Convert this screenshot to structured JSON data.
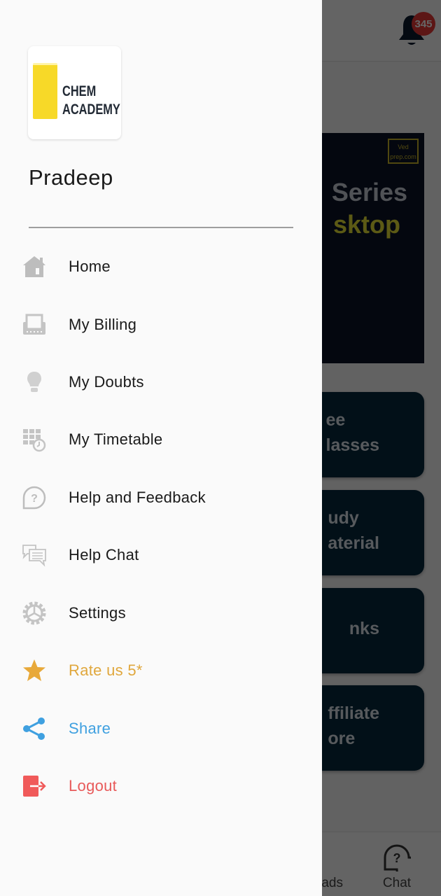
{
  "background": {
    "notification_count": "345",
    "banner": {
      "brand_line1": "Ved",
      "brand_line2": "prep.com",
      "title_line1": "Series",
      "title_line2": "sktop"
    },
    "cards": [
      {
        "label": "ee\nlasses"
      },
      {
        "label": "udy\naterial"
      },
      {
        "label": "nks"
      },
      {
        "label": "ffiliate\nore"
      }
    ],
    "bottom_nav": [
      {
        "label": "ads",
        "icon": "download-icon"
      },
      {
        "label": "Chat",
        "icon": "help-chat-icon"
      }
    ]
  },
  "drawer": {
    "logo": {
      "line1": "CHEM",
      "line2": "ACADEMY"
    },
    "user_name": "Pradeep",
    "menu": [
      {
        "label": "Home",
        "icon": "home-icon",
        "color": "#1a1a1a"
      },
      {
        "label": "My Billing",
        "icon": "billing-icon",
        "color": "#1a1a1a"
      },
      {
        "label": "My Doubts",
        "icon": "lightbulb-icon",
        "color": "#1a1a1a"
      },
      {
        "label": "My Timetable",
        "icon": "timetable-icon",
        "color": "#1a1a1a"
      },
      {
        "label": "Help and Feedback",
        "icon": "help-icon",
        "color": "#1a1a1a"
      },
      {
        "label": "Help Chat",
        "icon": "chat-icon",
        "color": "#1a1a1a"
      },
      {
        "label": "Settings",
        "icon": "gear-icon",
        "color": "#1a1a1a"
      },
      {
        "label": "Rate us 5*",
        "icon": "star-icon",
        "color": "#e0a73c"
      },
      {
        "label": "Share",
        "icon": "share-icon",
        "color": "#3fa0e0"
      },
      {
        "label": "Logout",
        "icon": "logout-icon",
        "color": "#e85a5a"
      }
    ]
  },
  "colors": {
    "rate": "#e0a73c",
    "share": "#3fa0e0",
    "logout": "#e85a5a",
    "icon_grey": "#bdbdbd",
    "card_bg": "#062a3e"
  }
}
